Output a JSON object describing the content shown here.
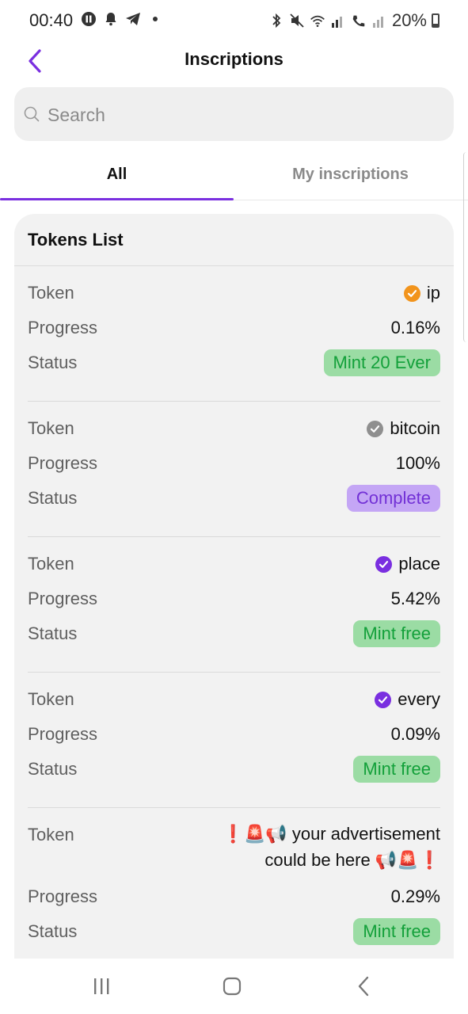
{
  "status_bar": {
    "time": "00:40",
    "battery": "20%"
  },
  "header": {
    "title": "Inscriptions"
  },
  "search": {
    "placeholder": "Search"
  },
  "tabs": [
    {
      "label": "All",
      "active": true
    },
    {
      "label": "My inscriptions",
      "active": false
    }
  ],
  "tokens_list": {
    "title": "Tokens List",
    "labels": {
      "token": "Token",
      "progress": "Progress",
      "status": "Status"
    },
    "items": [
      {
        "token": "ip",
        "verify_icon": "orange-check-icon",
        "progress": "0.16%",
        "status": "Mint 20 Ever",
        "status_color": "#13a03a"
      },
      {
        "token": "bitcoin",
        "verify_icon": "gray-check-icon",
        "progress": "100%",
        "status": "Complete",
        "status_color": "#7230d6"
      },
      {
        "token": "place",
        "verify_icon": "purple-check-icon",
        "progress": "5.42%",
        "status": "Mint free",
        "status_color": "#13a03a"
      },
      {
        "token": "every",
        "verify_icon": "purple-check-icon",
        "progress": "0.09%",
        "status": "Mint free",
        "status_color": "#13a03a"
      },
      {
        "token": "❗🚨📢 your advertisement could be here 📢🚨❗",
        "verify_icon": "",
        "progress": "0.29%",
        "status": "Mint free",
        "status_color": "#13a03a"
      }
    ]
  },
  "colors": {
    "accent": "#7a2fe0",
    "green_badge_bg": "#9bdca4",
    "purple_badge_bg": "#c4a6f5"
  }
}
